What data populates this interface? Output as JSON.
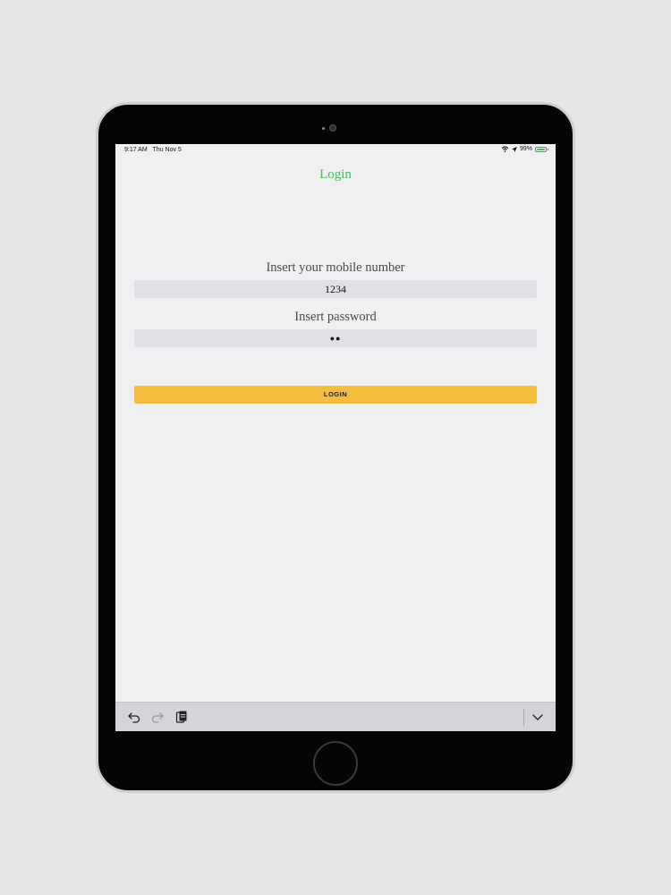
{
  "status_bar": {
    "time": "9:17 AM",
    "date": "Thu Nov 5",
    "battery": "99%",
    "battery_level": 0.99,
    "icons": [
      "wifi-icon",
      "location-arrow-icon",
      "battery-icon"
    ]
  },
  "nav": {
    "title": "Login",
    "title_color": "#3cc24f"
  },
  "form": {
    "mobile_label": "Insert your mobile number",
    "mobile_value": "1234",
    "password_label": "Insert password",
    "password_value": "●●",
    "login_button": "LOGIN",
    "button_color": "#f5bd3c"
  },
  "keyboard_toolbar": {
    "icons": [
      "undo-icon",
      "redo-icon",
      "paste-icon",
      "chevron-down-icon"
    ]
  }
}
